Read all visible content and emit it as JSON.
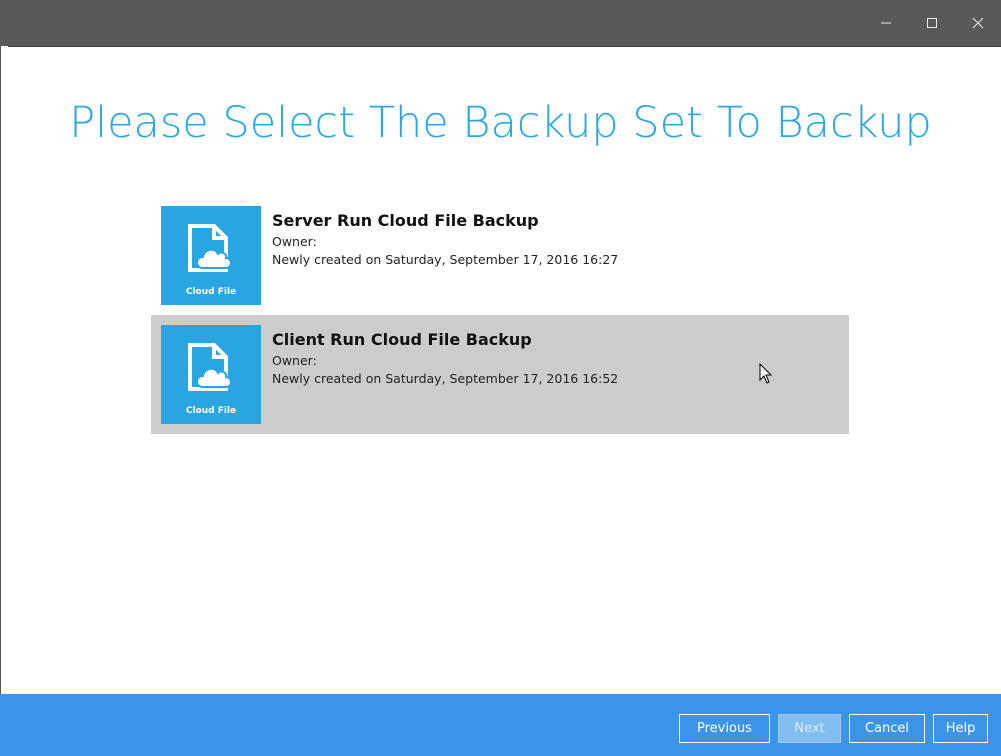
{
  "window": {
    "controls": [
      "minimize",
      "maximize",
      "close"
    ]
  },
  "page": {
    "title": "Please Select The Backup Set To Backup"
  },
  "backup_sets": [
    {
      "name": "Server Run Cloud File Backup",
      "owner": "Owner:",
      "created": "Newly created on Saturday, September 17, 2016 16:27",
      "tile_label": "Cloud File",
      "icon": "cloud-file-icon",
      "selected": false
    },
    {
      "name": "Client Run Cloud File Backup",
      "owner": "Owner:",
      "created": "Newly created on Saturday, September 17, 2016 16:52",
      "tile_label": "Cloud File",
      "icon": "cloud-file-icon",
      "selected": true
    }
  ],
  "footer": {
    "previous_label": "Previous",
    "next_label": "Next",
    "cancel_label": "Cancel",
    "help_label": "Help"
  },
  "colors": {
    "accent": "#2aa8e0",
    "tile": "#29a6e1",
    "footer": "#3c94e8",
    "titlebar": "#595959",
    "selected_row": "#cccccc"
  }
}
